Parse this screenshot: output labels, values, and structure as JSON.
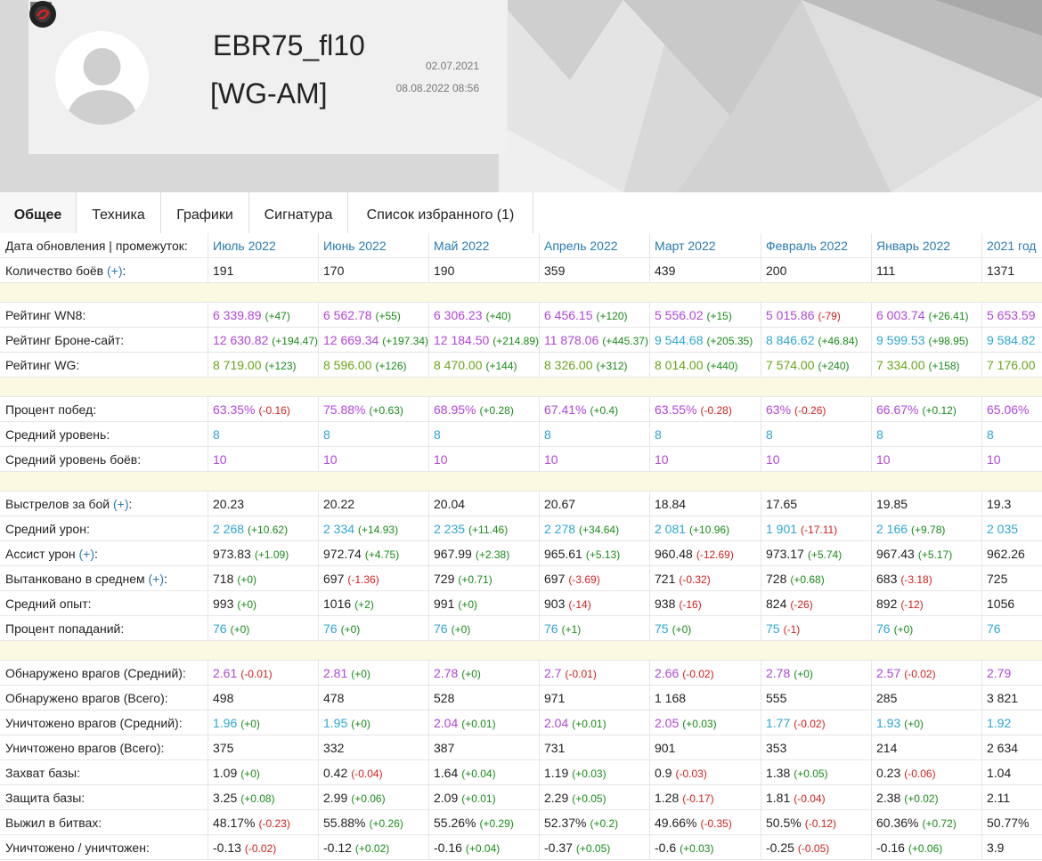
{
  "profile": {
    "nickname": "EBR75_fl10",
    "clan": "[WG-AM]",
    "date_created": "02.07.2021",
    "date_updated": "08.08.2022 08:56"
  },
  "tabs": [
    "Общее",
    "Техника",
    "Графики",
    "Сигнатура",
    "Список избранного (1)"
  ],
  "active_tab": 0,
  "colors": {
    "purple": "#b046d8",
    "cyan": "#2fa5d5",
    "green": "#6aa51c",
    "positive": "#1a8a1a",
    "negative": "#d02020",
    "link": "#2a7ab0",
    "separator": "#fcf9e2"
  },
  "table": {
    "header_label": "Дата обновления | промежуток:",
    "columns": [
      "Июль 2022",
      "Июнь 2022",
      "Май 2022",
      "Апрель 2022",
      "Март 2022",
      "Февраль 2022",
      "Январь 2022",
      "2021 год"
    ],
    "rows": [
      {
        "label": "Количество боёв",
        "plus": "(+)",
        "cells": [
          {
            "v": "191",
            "c": "plain"
          },
          {
            "v": "170",
            "c": "plain"
          },
          {
            "v": "190",
            "c": "plain"
          },
          {
            "v": "359",
            "c": "plain"
          },
          {
            "v": "439",
            "c": "plain"
          },
          {
            "v": "200",
            "c": "plain"
          },
          {
            "v": "111",
            "c": "plain"
          },
          {
            "v": "1371",
            "c": "plain"
          }
        ]
      },
      {
        "sep": true
      },
      {
        "label": "Рейтинг WN8:",
        "cells": [
          {
            "v": "6 339.89",
            "c": "purple",
            "d": "(+47)"
          },
          {
            "v": "6 562.78",
            "c": "purple",
            "d": "(+55)"
          },
          {
            "v": "6 306.23",
            "c": "purple",
            "d": "(+40)"
          },
          {
            "v": "6 456.15",
            "c": "purple",
            "d": "(+120)"
          },
          {
            "v": "5 556.02",
            "c": "purple",
            "d": "(+15)"
          },
          {
            "v": "5 015.86",
            "c": "purple",
            "d": "(-79)"
          },
          {
            "v": "6 003.74",
            "c": "purple",
            "d": "(+26.41)"
          },
          {
            "v": "5 653.59",
            "c": "purple"
          }
        ]
      },
      {
        "label": "Рейтинг Броне-сайт:",
        "cells": [
          {
            "v": "12 630.82",
            "c": "purple",
            "d": "(+194.47)"
          },
          {
            "v": "12 669.34",
            "c": "purple",
            "d": "(+197.34)"
          },
          {
            "v": "12 184.50",
            "c": "purple",
            "d": "(+214.89)"
          },
          {
            "v": "11 878.06",
            "c": "purple",
            "d": "(+445.37)"
          },
          {
            "v": "9 544.68",
            "c": "cyan",
            "d": "(+205.35)"
          },
          {
            "v": "8 846.62",
            "c": "cyan",
            "d": "(+46.84)"
          },
          {
            "v": "9 599.53",
            "c": "cyan",
            "d": "(+98.95)"
          },
          {
            "v": "9 584.82",
            "c": "cyan"
          }
        ]
      },
      {
        "label": "Рейтинг WG:",
        "cells": [
          {
            "v": "8 719.00",
            "c": "green",
            "d": "(+123)"
          },
          {
            "v": "8 596.00",
            "c": "green",
            "d": "(+126)"
          },
          {
            "v": "8 470.00",
            "c": "green",
            "d": "(+144)"
          },
          {
            "v": "8 326.00",
            "c": "green",
            "d": "(+312)"
          },
          {
            "v": "8 014.00",
            "c": "green",
            "d": "(+440)"
          },
          {
            "v": "7 574.00",
            "c": "green",
            "d": "(+240)"
          },
          {
            "v": "7 334.00",
            "c": "green",
            "d": "(+158)"
          },
          {
            "v": "7 176.00",
            "c": "green"
          }
        ]
      },
      {
        "sep": true
      },
      {
        "label": "Процент побед:",
        "cells": [
          {
            "v": "63.35%",
            "c": "purple",
            "d": "(-0.16)"
          },
          {
            "v": "75.88%",
            "c": "purple",
            "d": "(+0.63)"
          },
          {
            "v": "68.95%",
            "c": "purple",
            "d": "(+0.28)"
          },
          {
            "v": "67.41%",
            "c": "purple",
            "d": "(+0.4)"
          },
          {
            "v": "63.55%",
            "c": "purple",
            "d": "(-0.28)"
          },
          {
            "v": "63%",
            "c": "purple",
            "d": "(-0.26)"
          },
          {
            "v": "66.67%",
            "c": "purple",
            "d": "(+0.12)"
          },
          {
            "v": "65.06%",
            "c": "purple"
          }
        ]
      },
      {
        "label": "Средний уровень:",
        "cells": [
          {
            "v": "8",
            "c": "cyan"
          },
          {
            "v": "8",
            "c": "cyan"
          },
          {
            "v": "8",
            "c": "cyan"
          },
          {
            "v": "8",
            "c": "cyan"
          },
          {
            "v": "8",
            "c": "cyan"
          },
          {
            "v": "8",
            "c": "cyan"
          },
          {
            "v": "8",
            "c": "cyan"
          },
          {
            "v": "8",
            "c": "cyan"
          }
        ]
      },
      {
        "label": "Средний уровень боёв:",
        "cells": [
          {
            "v": "10",
            "c": "purple"
          },
          {
            "v": "10",
            "c": "purple"
          },
          {
            "v": "10",
            "c": "purple"
          },
          {
            "v": "10",
            "c": "purple"
          },
          {
            "v": "10",
            "c": "purple"
          },
          {
            "v": "10",
            "c": "purple"
          },
          {
            "v": "10",
            "c": "purple"
          },
          {
            "v": "10",
            "c": "purple"
          }
        ]
      },
      {
        "sep": true
      },
      {
        "label": "Выстрелов за бой",
        "plus": "(+)",
        "suffix": ":",
        "cells": [
          {
            "v": "20.23",
            "c": "plain"
          },
          {
            "v": "20.22",
            "c": "plain"
          },
          {
            "v": "20.04",
            "c": "plain"
          },
          {
            "v": "20.67",
            "c": "plain"
          },
          {
            "v": "18.84",
            "c": "plain"
          },
          {
            "v": "17.65",
            "c": "plain"
          },
          {
            "v": "19.85",
            "c": "plain"
          },
          {
            "v": "19.3",
            "c": "plain"
          }
        ]
      },
      {
        "label": "Средний урон:",
        "cells": [
          {
            "v": "2 268",
            "c": "cyan",
            "d": "(+10.62)"
          },
          {
            "v": "2 334",
            "c": "cyan",
            "d": "(+14.93)"
          },
          {
            "v": "2 235",
            "c": "cyan",
            "d": "(+11.46)"
          },
          {
            "v": "2 278",
            "c": "cyan",
            "d": "(+34.64)"
          },
          {
            "v": "2 081",
            "c": "cyan",
            "d": "(+10.96)"
          },
          {
            "v": "1 901",
            "c": "cyan",
            "d": "(-17.11)"
          },
          {
            "v": "2 166",
            "c": "cyan",
            "d": "(+9.78)"
          },
          {
            "v": "2 035",
            "c": "cyan"
          }
        ]
      },
      {
        "label": "Ассист урон",
        "plus": "(+)",
        "suffix": ":",
        "cells": [
          {
            "v": "973.83",
            "c": "plain",
            "d": "(+1.09)"
          },
          {
            "v": "972.74",
            "c": "plain",
            "d": "(+4.75)"
          },
          {
            "v": "967.99",
            "c": "plain",
            "d": "(+2.38)"
          },
          {
            "v": "965.61",
            "c": "plain",
            "d": "(+5.13)"
          },
          {
            "v": "960.48",
            "c": "plain",
            "d": "(-12.69)"
          },
          {
            "v": "973.17",
            "c": "plain",
            "d": "(+5.74)"
          },
          {
            "v": "967.43",
            "c": "plain",
            "d": "(+5.17)"
          },
          {
            "v": "962.26",
            "c": "plain"
          }
        ]
      },
      {
        "label": "Вытанковано в среднем",
        "plus": "(+)",
        "suffix": ":",
        "cells": [
          {
            "v": "718",
            "c": "plain",
            "d": "(+0)"
          },
          {
            "v": "697",
            "c": "plain",
            "d": "(-1.36)"
          },
          {
            "v": "729",
            "c": "plain",
            "d": "(+0.71)"
          },
          {
            "v": "697",
            "c": "plain",
            "d": "(-3.69)"
          },
          {
            "v": "721",
            "c": "plain",
            "d": "(-0.32)"
          },
          {
            "v": "728",
            "c": "plain",
            "d": "(+0.68)"
          },
          {
            "v": "683",
            "c": "plain",
            "d": "(-3.18)"
          },
          {
            "v": "725",
            "c": "plain"
          }
        ]
      },
      {
        "label": "Средний опыт:",
        "cells": [
          {
            "v": "993",
            "c": "plain",
            "d": "(+0)"
          },
          {
            "v": "1016",
            "c": "plain",
            "d": "(+2)"
          },
          {
            "v": "991",
            "c": "plain",
            "d": "(+0)"
          },
          {
            "v": "903",
            "c": "plain",
            "d": "(-14)"
          },
          {
            "v": "938",
            "c": "plain",
            "d": "(-16)"
          },
          {
            "v": "824",
            "c": "plain",
            "d": "(-26)"
          },
          {
            "v": "892",
            "c": "plain",
            "d": "(-12)"
          },
          {
            "v": "1056",
            "c": "plain"
          }
        ]
      },
      {
        "label": "Процент попаданий:",
        "cells": [
          {
            "v": "76",
            "c": "cyan",
            "d": "(+0)"
          },
          {
            "v": "76",
            "c": "cyan",
            "d": "(+0)"
          },
          {
            "v": "76",
            "c": "cyan",
            "d": "(+0)"
          },
          {
            "v": "76",
            "c": "cyan",
            "d": "(+1)"
          },
          {
            "v": "75",
            "c": "cyan",
            "d": "(+0)"
          },
          {
            "v": "75",
            "c": "cyan",
            "d": "(-1)"
          },
          {
            "v": "76",
            "c": "cyan",
            "d": "(+0)"
          },
          {
            "v": "76",
            "c": "cyan"
          }
        ]
      },
      {
        "sep": true
      },
      {
        "label": "Обнаружено врагов (Средний):",
        "cells": [
          {
            "v": "2.61",
            "c": "purple",
            "d": "(-0.01)"
          },
          {
            "v": "2.81",
            "c": "purple",
            "d": "(+0)"
          },
          {
            "v": "2.78",
            "c": "purple",
            "d": "(+0)"
          },
          {
            "v": "2.7",
            "c": "purple",
            "d": "(-0.01)"
          },
          {
            "v": "2.66",
            "c": "purple",
            "d": "(-0.02)"
          },
          {
            "v": "2.78",
            "c": "purple",
            "d": "(+0)"
          },
          {
            "v": "2.57",
            "c": "purple",
            "d": "(-0.02)"
          },
          {
            "v": "2.79",
            "c": "purple"
          }
        ]
      },
      {
        "label": "Обнаружено врагов (Всего):",
        "cells": [
          {
            "v": "498",
            "c": "plain"
          },
          {
            "v": "478",
            "c": "plain"
          },
          {
            "v": "528",
            "c": "plain"
          },
          {
            "v": "971",
            "c": "plain"
          },
          {
            "v": "1 168",
            "c": "plain"
          },
          {
            "v": "555",
            "c": "plain"
          },
          {
            "v": "285",
            "c": "plain"
          },
          {
            "v": "3 821",
            "c": "plain"
          }
        ]
      },
      {
        "label": "Уничтожено врагов (Средний):",
        "cells": [
          {
            "v": "1.96",
            "c": "cyan",
            "d": "(+0)"
          },
          {
            "v": "1.95",
            "c": "cyan",
            "d": "(+0)"
          },
          {
            "v": "2.04",
            "c": "purple",
            "d": "(+0.01)"
          },
          {
            "v": "2.04",
            "c": "purple",
            "d": "(+0.01)"
          },
          {
            "v": "2.05",
            "c": "purple",
            "d": "(+0.03)"
          },
          {
            "v": "1.77",
            "c": "cyan",
            "d": "(-0.02)"
          },
          {
            "v": "1.93",
            "c": "cyan",
            "d": "(+0)"
          },
          {
            "v": "1.92",
            "c": "cyan"
          }
        ]
      },
      {
        "label": "Уничтожено врагов (Всего):",
        "cells": [
          {
            "v": "375",
            "c": "plain"
          },
          {
            "v": "332",
            "c": "plain"
          },
          {
            "v": "387",
            "c": "plain"
          },
          {
            "v": "731",
            "c": "plain"
          },
          {
            "v": "901",
            "c": "plain"
          },
          {
            "v": "353",
            "c": "plain"
          },
          {
            "v": "214",
            "c": "plain"
          },
          {
            "v": "2 634",
            "c": "plain"
          }
        ]
      },
      {
        "label": "Захват базы:",
        "cells": [
          {
            "v": "1.09",
            "c": "plain",
            "d": "(+0)"
          },
          {
            "v": "0.42",
            "c": "plain",
            "d": "(-0.04)"
          },
          {
            "v": "1.64",
            "c": "plain",
            "d": "(+0.04)"
          },
          {
            "v": "1.19",
            "c": "plain",
            "d": "(+0.03)"
          },
          {
            "v": "0.9",
            "c": "plain",
            "d": "(-0.03)"
          },
          {
            "v": "1.38",
            "c": "plain",
            "d": "(+0.05)"
          },
          {
            "v": "0.23",
            "c": "plain",
            "d": "(-0.06)"
          },
          {
            "v": "1.04",
            "c": "plain"
          }
        ]
      },
      {
        "label": "Защита базы:",
        "cells": [
          {
            "v": "3.25",
            "c": "plain",
            "d": "(+0.08)"
          },
          {
            "v": "2.99",
            "c": "plain",
            "d": "(+0.06)"
          },
          {
            "v": "2.09",
            "c": "plain",
            "d": "(+0.01)"
          },
          {
            "v": "2.29",
            "c": "plain",
            "d": "(+0.05)"
          },
          {
            "v": "1.28",
            "c": "plain",
            "d": "(-0.17)"
          },
          {
            "v": "1.81",
            "c": "plain",
            "d": "(-0.04)"
          },
          {
            "v": "2.38",
            "c": "plain",
            "d": "(+0.02)"
          },
          {
            "v": "2.11",
            "c": "plain"
          }
        ]
      },
      {
        "label": "Выжил в битвах:",
        "cells": [
          {
            "v": "48.17%",
            "c": "plain",
            "d": "(-0.23)"
          },
          {
            "v": "55.88%",
            "c": "plain",
            "d": "(+0.26)"
          },
          {
            "v": "55.26%",
            "c": "plain",
            "d": "(+0.29)"
          },
          {
            "v": "52.37%",
            "c": "plain",
            "d": "(+0.2)"
          },
          {
            "v": "49.66%",
            "c": "plain",
            "d": "(-0.35)"
          },
          {
            "v": "50.5%",
            "c": "plain",
            "d": "(-0.12)"
          },
          {
            "v": "60.36%",
            "c": "plain",
            "d": "(+0.72)"
          },
          {
            "v": "50.77%",
            "c": "plain"
          }
        ]
      },
      {
        "label": "Уничтожено / уничтожен:",
        "cells": [
          {
            "v": "-0.13",
            "c": "plain",
            "d": "(-0.02)"
          },
          {
            "v": "-0.12",
            "c": "plain",
            "d": "(+0.02)"
          },
          {
            "v": "-0.16",
            "c": "plain",
            "d": "(+0.04)"
          },
          {
            "v": "-0.37",
            "c": "plain",
            "d": "(+0.05)"
          },
          {
            "v": "-0.6",
            "c": "plain",
            "d": "(+0.03)"
          },
          {
            "v": "-0.25",
            "c": "plain",
            "d": "(-0.05)"
          },
          {
            "v": "-0.16",
            "c": "plain",
            "d": "(+0.06)"
          },
          {
            "v": "3.9",
            "c": "plain"
          }
        ]
      }
    ]
  }
}
